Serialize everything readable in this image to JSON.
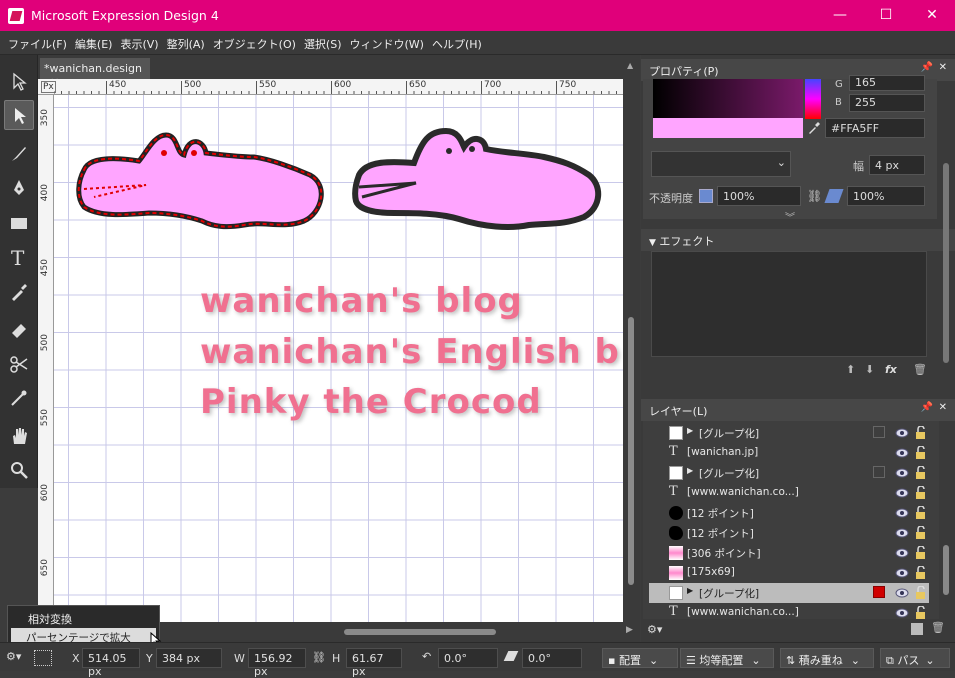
{
  "window": {
    "title": "Microsoft Expression Design 4",
    "minimize": "—",
    "maximize": "☐",
    "close": "✕"
  },
  "menu": [
    "ファイル(F)",
    "編集(E)",
    "表示(V)",
    "整列(A)",
    "オブジェクト(O)",
    "選択(S)",
    "ウィンドウ(W)",
    "ヘルプ(H)"
  ],
  "document": {
    "tab_label": "*wanichan.design",
    "tab_close": "×"
  },
  "ruler": {
    "unit": "Px",
    "top_ticks": [
      "450",
      "500",
      "550",
      "600",
      "650",
      "700",
      "750"
    ],
    "left_ticks": [
      "350",
      "400",
      "450",
      "500",
      "550",
      "600",
      "650"
    ]
  },
  "canvas": {
    "lines": [
      "wanichan's blog",
      "wanichan's English b",
      "Pinky the Crocod"
    ],
    "text_color": "#f07090",
    "shape_color": "#ffa5ff"
  },
  "properties": {
    "title": "プロパティ(P)",
    "g_label": "G",
    "g_value": "165",
    "b_label": "B",
    "b_value": "255",
    "hex": "#FFA5FF",
    "width_label": "幅",
    "width_value": "4 px",
    "opacity_label": "不透明度",
    "opacity1": "100%",
    "opacity2": "100%",
    "swatch_color": "#ffa5ff"
  },
  "effects": {
    "title": "エフェクト",
    "fx": "fx"
  },
  "layers": {
    "title": "レイヤー(L)",
    "rows": [
      {
        "label": "[グループ化]",
        "expand": "▶",
        "kind": "group"
      },
      {
        "label": "[wanichan.jp]",
        "expand": "",
        "kind": "text"
      },
      {
        "label": "[グループ化]",
        "expand": "▶",
        "kind": "group"
      },
      {
        "label": "[www.wanichan.co...]",
        "expand": "",
        "kind": "text"
      },
      {
        "label": "[12 ポイント]",
        "expand": "",
        "kind": "blob"
      },
      {
        "label": "[12 ポイント]",
        "expand": "",
        "kind": "blob2"
      },
      {
        "label": "[306 ポイント]",
        "expand": "",
        "kind": "img"
      },
      {
        "label": "[175x69]",
        "expand": "",
        "kind": "img"
      },
      {
        "label": "[グループ化]",
        "expand": "▶",
        "kind": "group-selected"
      },
      {
        "label": "[www.wanichan.co...]",
        "expand": "",
        "kind": "text"
      }
    ]
  },
  "popup": {
    "item1": "相対変換",
    "item2": "パーセンテージで拡大縮小"
  },
  "status": {
    "x_label": "X",
    "x_value": "514.05 px",
    "y_label": "Y",
    "y_value": "384 px",
    "w_label": "W",
    "w_value": "156.92 px",
    "h_label": "H",
    "h_value": "61.67 px",
    "rotate_value": "0.0°",
    "skew_value": "0.0°",
    "align": "配置",
    "distribute": "均等配置",
    "arrange": "積み重ね",
    "path": "パス"
  }
}
